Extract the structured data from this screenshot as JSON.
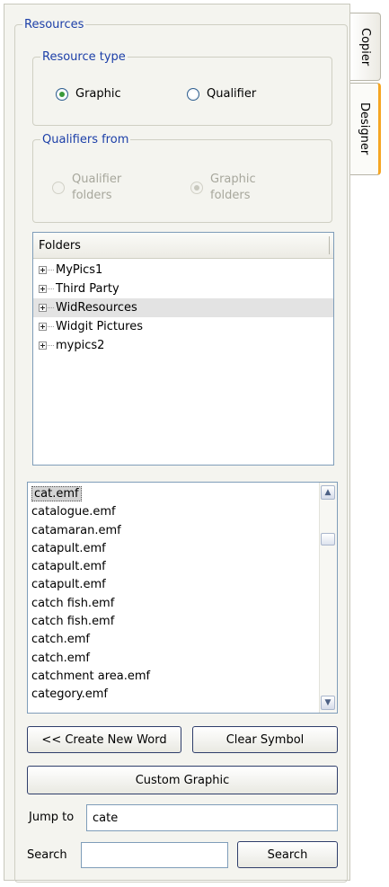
{
  "tabs": [
    {
      "label": "Copier",
      "active": false
    },
    {
      "label": "Designer",
      "active": true
    }
  ],
  "resources": {
    "legend": "Resources",
    "resource_type": {
      "legend": "Resource type",
      "options": [
        "Graphic",
        "Qualifier"
      ],
      "selected": "Graphic"
    },
    "qualifiers_from": {
      "legend": "Qualifiers from",
      "enabled": false,
      "options": [
        {
          "line1": "Qualifier",
          "line2": "folders"
        },
        {
          "line1": "Graphic",
          "line2": "folders"
        }
      ],
      "selected": "Graphic folders"
    }
  },
  "folders": {
    "header": "Folders",
    "items": [
      "MyPics1",
      "Third Party",
      "WidResources",
      "Widgit Pictures",
      "mypics2"
    ],
    "selected_index": 2
  },
  "file_list": {
    "items": [
      "cat.emf",
      "catalogue.emf",
      "catamaran.emf",
      "catapult.emf",
      "catapult.emf",
      "catapult.emf",
      "catch fish.emf",
      "catch fish.emf",
      "catch.emf",
      "catch.emf",
      "catchment area.emf",
      "category.emf"
    ],
    "selected_index": 0
  },
  "buttons": {
    "create_new_word": "<< Create New Word",
    "clear_symbol": "Clear Symbol",
    "custom_graphic": "Custom Graphic",
    "search": "Search"
  },
  "jump_to": {
    "label": "Jump to",
    "value": "cate"
  },
  "search": {
    "label": "Search",
    "value": ""
  },
  "colors": {
    "legend_text": "#1c3fa8",
    "active_tab_accent": "#f5a623",
    "panel_bg": "#f4f4ef"
  }
}
